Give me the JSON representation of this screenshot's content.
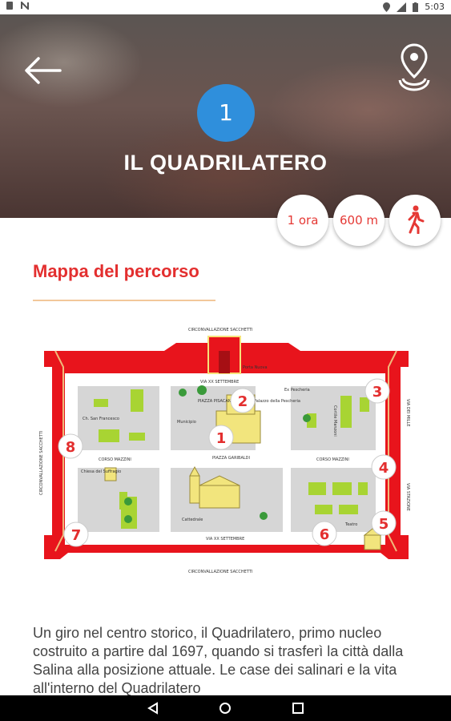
{
  "status": {
    "time": "5:03"
  },
  "header": {
    "route_number": "1",
    "title": "IL QUADRILATERO"
  },
  "stats": {
    "duration": "1 ora",
    "distance": "600 m",
    "mode_icon": "walking-icon"
  },
  "section": {
    "title": "Mappa del percorso"
  },
  "map": {
    "street_labels": {
      "top": "CIRCONVALLAZIONE SACCHETTI",
      "bottom": "CIRCONVALLAZIONE SACCHETTI",
      "left": "CIRCONVALLAZIONE SACCHETTI",
      "right_upper": "VIA DEI MILLE",
      "right_lower": "VIA STAZIONE",
      "xx_top": "VIA XX SETTEMBRE",
      "xx_bottom": "VIA XX SETTEMBRE",
      "mazzini_left": "CORSO MAZZINI",
      "mazzini_right": "CORSO MAZZINI"
    },
    "place_labels": {
      "porta": "Porta Nuova",
      "pescheria": "Ex Pescheria",
      "piazza_pisacane": "PIAZZA PISACANE",
      "palazzo": "Palazzo della Pescheria",
      "municipio": "Municipio",
      "piazza_garibaldi": "PIAZZA GARIBALDI",
      "san_francesco": "Ch. San Francesco",
      "chiesa_suffragio": "Chiesa del Suffragio",
      "cattedrale": "Cattedrale",
      "teatro": "Teatro",
      "cortile": "Cortile Manzoni"
    },
    "stops": [
      "1",
      "2",
      "3",
      "4",
      "5",
      "6",
      "7",
      "8"
    ]
  },
  "description": "Un giro nel centro storico, il Quadrilatero, primo nucleo costruito a partire dal 1697, quando si trasferì la città dalla Salina alla posizione attuale. Le case dei salinari e la vita all'interno del Quadrilatero"
}
